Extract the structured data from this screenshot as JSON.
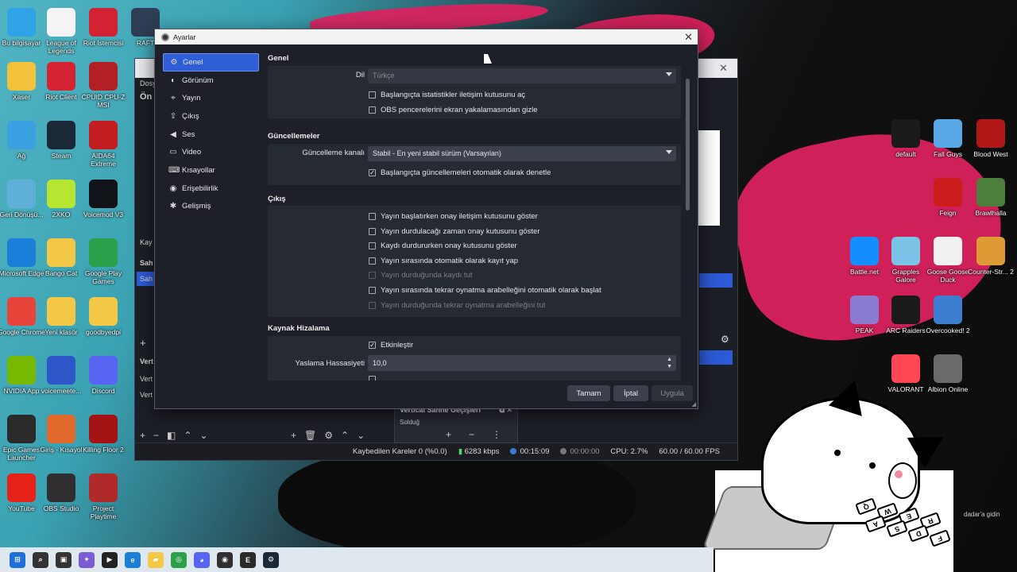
{
  "desktop": {
    "left_icons": [
      {
        "label": "Bu bilgisayar",
        "color": "#2fa3e6"
      },
      {
        "label": "League of Legends",
        "color": "#f4f4f4"
      },
      {
        "label": "Riot İstemcisi",
        "color": "#d32333"
      },
      {
        "label": "RAFT",
        "color": "#2d3e55"
      },
      {
        "label": "Xaser",
        "color": "#f2c23b"
      },
      {
        "label": "Riot Client",
        "color": "#d32333"
      },
      {
        "label": "CPUID CPU-Z MSI",
        "color": "#b22026"
      },
      {
        "label": "Ağ",
        "color": "#3aa0e0"
      },
      {
        "label": "Steam",
        "color": "#1b2838"
      },
      {
        "label": "AIDA64 Extreme",
        "color": "#c21d21"
      },
      {
        "label": "Geri Dönüşü...",
        "color": "#5fb0d8"
      },
      {
        "label": "2XKO",
        "color": "#b6e532"
      },
      {
        "label": "Voicemod V3",
        "color": "#101418"
      },
      {
        "label": "Microsoft Edge",
        "color": "#1a7fd8"
      },
      {
        "label": "Bango Cat",
        "color": "#f3c846"
      },
      {
        "label": "Google Play Games",
        "color": "#2b9f4a"
      },
      {
        "label": "Google Chrome",
        "color": "#e7453a"
      },
      {
        "label": "Yeni klasör",
        "color": "#f3c846"
      },
      {
        "label": "goodbyedpi",
        "color": "#f3c846"
      },
      {
        "label": "NVIDIA App",
        "color": "#76b900"
      },
      {
        "label": "voicemeete...",
        "color": "#2e56c8"
      },
      {
        "label": "Discord",
        "color": "#5865f2"
      },
      {
        "label": "Epic Games Launcher",
        "color": "#2a2a2a"
      },
      {
        "label": "Giriş - Kısayol",
        "color": "#e06a2c"
      },
      {
        "label": "Killing Floor 2",
        "color": "#a31313"
      },
      {
        "label": "YouTube",
        "color": "#e62117"
      },
      {
        "label": "OBS Studio",
        "color": "#302e31"
      },
      {
        "label": "Project Playtime",
        "color": "#b02a2a"
      }
    ],
    "right_icons": [
      {
        "label": "default",
        "color": "#1a1a1a"
      },
      {
        "label": "Fall Guys",
        "color": "#5aa7e5"
      },
      {
        "label": "Blood West",
        "color": "#b01818"
      },
      {
        "label": "Feign",
        "color": "#cc1c1c"
      },
      {
        "label": "Brawlhalla",
        "color": "#4b7f3b"
      },
      {
        "label": "Battle.net",
        "color": "#148eff"
      },
      {
        "label": "Grapples Galore",
        "color": "#7bc3e6"
      },
      {
        "label": "Goose Goose Duck",
        "color": "#f1f1f1"
      },
      {
        "label": "Counter-Str... 2",
        "color": "#de9b35"
      },
      {
        "label": "PEAK",
        "color": "#8a7bd1"
      },
      {
        "label": "ARC Raiders",
        "color": "#1a1a1a"
      },
      {
        "label": "Overcooked! 2",
        "color": "#3c7fd0"
      },
      {
        "label": "VALORANT",
        "color": "#ff4655"
      },
      {
        "label": "Albion Online",
        "color": "#6a6a6a"
      }
    ]
  },
  "obs_main": {
    "left_labels": [
      "Dosy",
      "Ön",
      "Kay",
      "Sah",
      "Sah",
      "Vert",
      "Vert",
      "Vert"
    ],
    "transitions_title": "Vertical Sahne Geçişleri",
    "transitions_value": "Solduğ",
    "status": {
      "dropped": "Kaybedilen Kareler 0 (%0.0)",
      "bitrate": "6283 kbps",
      "stream_time": "00:15:09",
      "rec_time": "00:00:00",
      "cpu": "CPU: 2.7%",
      "fps": "60.00 / 60.00 FPS"
    }
  },
  "settings": {
    "title": "Ayarlar",
    "nav": [
      {
        "label": "Genel",
        "icon": "gear-icon",
        "glyph": "⚙",
        "active": true
      },
      {
        "label": "Görünüm",
        "icon": "brush-icon",
        "glyph": "◐",
        "active": false
      },
      {
        "label": "Yayın",
        "icon": "broadcast-icon",
        "glyph": "⌖",
        "active": false
      },
      {
        "label": "Çıkış",
        "icon": "output-icon",
        "glyph": "⇪",
        "active": false
      },
      {
        "label": "Ses",
        "icon": "speaker-icon",
        "glyph": "◀",
        "active": false
      },
      {
        "label": "Video",
        "icon": "monitor-icon",
        "glyph": "▭",
        "active": false
      },
      {
        "label": "Kısayollar",
        "icon": "keyboard-icon",
        "glyph": "⌨",
        "active": false
      },
      {
        "label": "Erişebilirlik",
        "icon": "accessibility-icon",
        "glyph": "◉",
        "active": false
      },
      {
        "label": "Gelişmiş",
        "icon": "wrench-icon",
        "glyph": "✱",
        "active": false
      }
    ],
    "general": {
      "header": "Genel",
      "language_label": "Dil",
      "language_value": "Türkçe",
      "chk_startup_dialog": "Başlangıçta istatistikler iletişim kutusunu aç",
      "chk_hide_windows": "OBS pencerelerini ekran yakalamasından gizle"
    },
    "updates": {
      "header": "Güncellemeler",
      "channel_label": "Güncelleme kanalı",
      "channel_value": "Stabil - En yeni stabil sürüm (Varsayılan)",
      "chk_auto_check": "Başlangıçta güncellemeleri otomatik olarak denetle"
    },
    "output": {
      "header": "Çıkış",
      "items": [
        {
          "label": "Yayın başlatırken onay iletişim kutusunu göster",
          "checked": false,
          "disabled": false
        },
        {
          "label": "Yayın durdulacağı zaman onay kutusunu göster",
          "checked": false,
          "disabled": false
        },
        {
          "label": "Kaydı durdururken onay kutusunu göster",
          "checked": false,
          "disabled": false
        },
        {
          "label": "Yayın sırasında otomatik olarak kayıt yap",
          "checked": false,
          "disabled": false
        },
        {
          "label": "Yayın durduğunda kaydı tut",
          "checked": false,
          "disabled": true
        },
        {
          "label": "Yayın sırasında tekrar oynatma arabelleğini otomatik olarak başlat",
          "checked": false,
          "disabled": false
        },
        {
          "label": "Yayın durduğunda tekrar oynatma arabelleğini tut",
          "checked": false,
          "disabled": true
        }
      ]
    },
    "snapping": {
      "header": "Kaynak Hizalama",
      "chk_enable": "Etkinleştir",
      "sensitivity_label": "Yaslama Hassasiyeti",
      "sensitivity_value": "10,0"
    },
    "buttons": {
      "ok": "Tamam",
      "cancel": "İptal",
      "apply": "Uygula"
    }
  },
  "taskbar": {
    "icons": [
      {
        "name": "start-icon",
        "color": "#1e6fd9",
        "glyph": "⊞"
      },
      {
        "name": "search-icon",
        "color": "#333333",
        "glyph": "⌕"
      },
      {
        "name": "task-view-icon",
        "color": "#333333",
        "glyph": "▣"
      },
      {
        "name": "copilot-icon",
        "color": "#7c5cd6",
        "glyph": "✦"
      },
      {
        "name": "media-player-icon",
        "color": "#222222",
        "glyph": "▶"
      },
      {
        "name": "edge-icon",
        "color": "#1a7fd8",
        "glyph": "e"
      },
      {
        "name": "file-explorer-icon",
        "color": "#f3c846",
        "glyph": "▰"
      },
      {
        "name": "chrome-icon",
        "color": "#2b9f4a",
        "glyph": "◎"
      },
      {
        "name": "discord-icon",
        "color": "#5865f2",
        "glyph": "◕"
      },
      {
        "name": "obs-icon",
        "color": "#302e31",
        "glyph": "◉"
      },
      {
        "name": "epic-icon",
        "color": "#2a2a2a",
        "glyph": "E"
      },
      {
        "name": "steam-icon",
        "color": "#1b2838",
        "glyph": "⚙"
      }
    ]
  },
  "cat_keys": [
    "Q",
    "W",
    "E",
    "R",
    "A",
    "S",
    "D",
    "F"
  ],
  "cat_caption": "dadar'a gidin"
}
